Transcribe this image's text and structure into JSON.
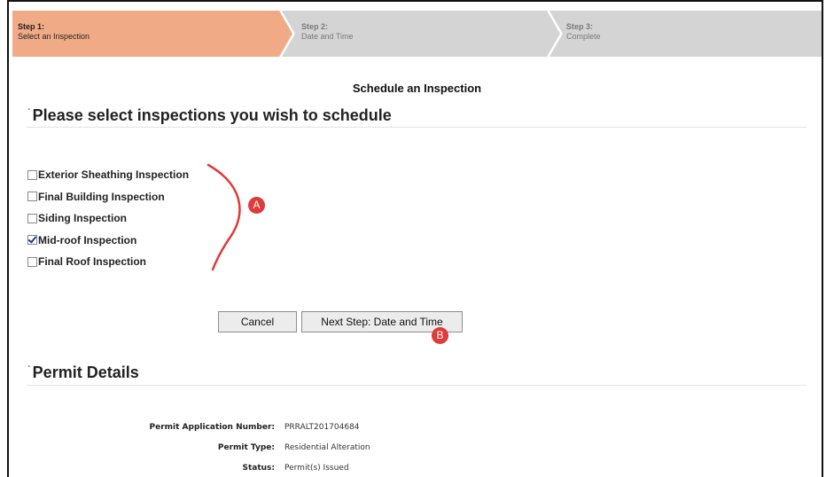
{
  "steps": [
    {
      "number": "Step 1:",
      "label": "Select an Inspection",
      "state": "active"
    },
    {
      "number": "Step 2:",
      "label": "Date and Time",
      "state": "inactive"
    },
    {
      "number": "Step 3:",
      "label": "Complete",
      "state": "inactive"
    }
  ],
  "page_title": "Schedule an Inspection",
  "inspections_section": {
    "heading": "Please select inspections you wish to schedule",
    "items": [
      {
        "label": "Exterior Sheathing Inspection",
        "checked": false
      },
      {
        "label": "Final Building Inspection",
        "checked": false
      },
      {
        "label": "Siding Inspection",
        "checked": false
      },
      {
        "label": "Mid-roof Inspection",
        "checked": true
      },
      {
        "label": "Final Roof Inspection",
        "checked": false
      }
    ]
  },
  "buttons": {
    "cancel": "Cancel",
    "next": "Next Step: Date and Time"
  },
  "annotations": {
    "a": "A",
    "b": "B"
  },
  "permit_section": {
    "heading": "Permit Details",
    "rows": [
      {
        "label": "Permit Application Number:",
        "value": "PRRALT201704684"
      },
      {
        "label": "Permit Type:",
        "value": "Residential Alteration"
      },
      {
        "label": "Status:",
        "value": "Permit(s) Issued"
      }
    ]
  },
  "colors": {
    "active_step": "#f0ab86",
    "inactive_step": "#d4d4d4",
    "annotation": "#e03a3a"
  }
}
